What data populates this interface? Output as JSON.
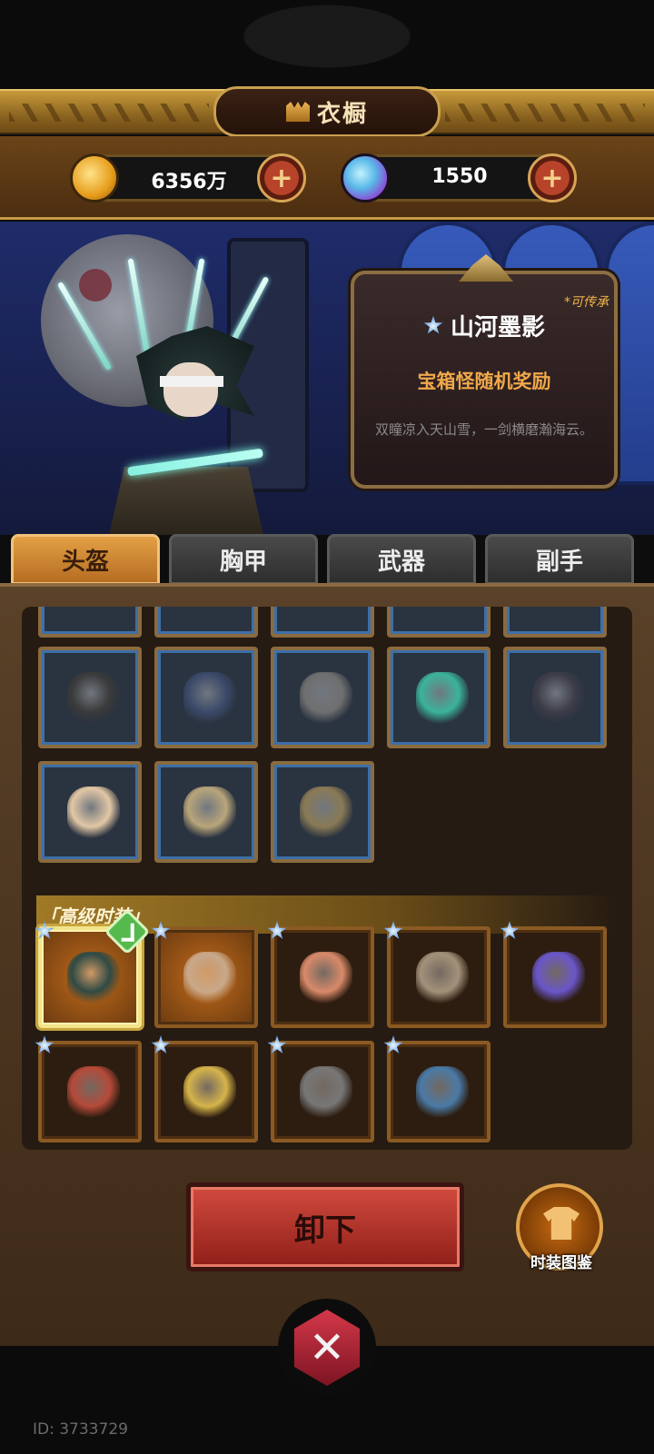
{
  "header": {
    "title": "衣橱"
  },
  "currency": {
    "coins": "6356万",
    "gems": "1550",
    "plus": "+"
  },
  "info": {
    "inherit_tag": "*可传承",
    "name": "山河墨影",
    "source": "宝箱怪随机奖励",
    "description": "双瞳凉入天山雪，一剑横磨瀚海云。"
  },
  "tabs": [
    {
      "label": "头盔",
      "active": true
    },
    {
      "label": "胸甲",
      "active": false
    },
    {
      "label": "武器",
      "active": false
    },
    {
      "label": "副手",
      "active": false
    }
  ],
  "normal_items": [
    {
      "icon": "iron-helmet-icon",
      "color": "#3a3a3a"
    },
    {
      "icon": "yinyang-cap-icon",
      "color": "#3b4a6a"
    },
    {
      "icon": "witch-hat-icon",
      "color": "#6f6f6f"
    },
    {
      "icon": "jade-mask-icon",
      "color": "#3bb39a"
    },
    {
      "icon": "dark-crown-icon",
      "color": "#3c3c48"
    },
    {
      "icon": "feather-hood-icon",
      "color": "#e2c7a5"
    },
    {
      "icon": "horned-helm-icon",
      "color": "#b9a57a"
    },
    {
      "icon": "lantern-hat-icon",
      "color": "#8a7a55"
    }
  ],
  "section": {
    "title": "「高级时装」"
  },
  "premium_items": [
    {
      "icon": "blindfold-hero-icon",
      "color": "#2f4a44",
      "selected": true
    },
    {
      "icon": "curtain-crown-icon",
      "color": "#c9a98a",
      "selected": false
    },
    {
      "icon": "mahjong-fa-tile-icon",
      "color": "#d98a6a",
      "selected": false
    },
    {
      "icon": "ribbon-bow-icon",
      "color": "#a3927a",
      "selected": false
    },
    {
      "icon": "bunny-heart-icon",
      "color": "#6a56c9",
      "selected": false
    },
    {
      "icon": "red-crown-icon",
      "color": "#b54a3a",
      "selected": false
    },
    {
      "icon": "pharaoh-headdress-icon",
      "color": "#d6b44a",
      "selected": false
    },
    {
      "icon": "samurai-wig-icon",
      "color": "#777777",
      "selected": false
    },
    {
      "icon": "bucket-hat-icon",
      "color": "#4a7aa6",
      "selected": false
    }
  ],
  "actions": {
    "unequip": "卸下",
    "atlas": "时装图鉴",
    "close": "✕"
  },
  "footer": {
    "id": "ID: 3733729"
  }
}
